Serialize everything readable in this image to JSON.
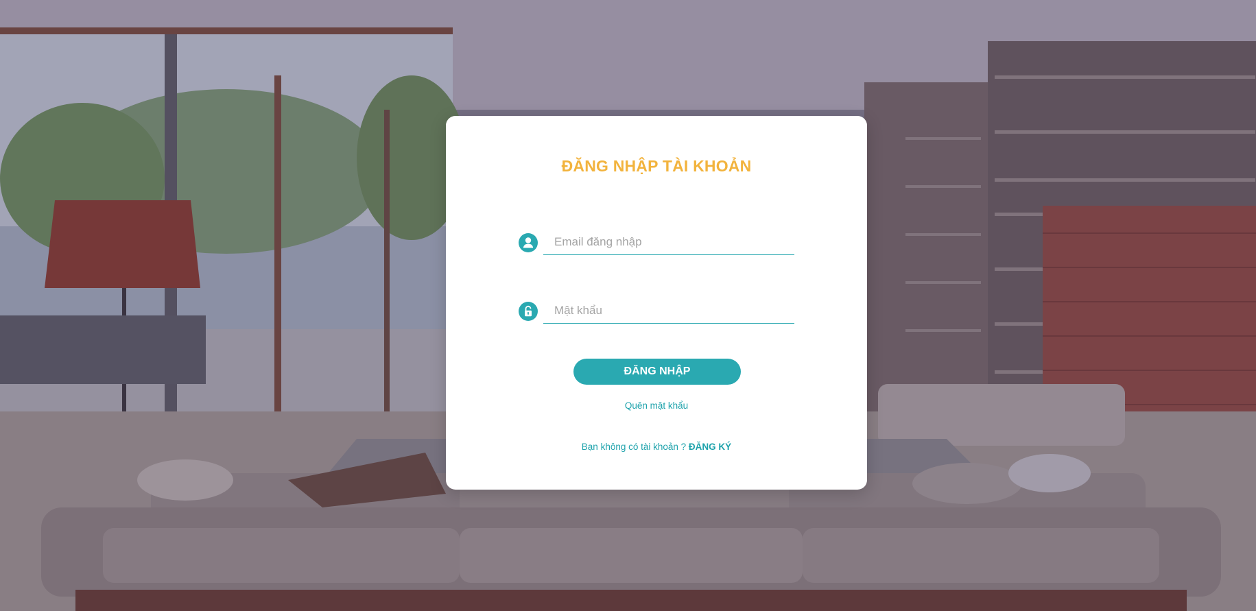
{
  "colors": {
    "accent": "#2aa9b1",
    "title": "#f2b33d",
    "link": "#1fa3ac"
  },
  "login": {
    "title": "ĐĂNG NHẬP TÀI KHOẢN",
    "email": {
      "icon": "user-icon",
      "placeholder": "Email đăng nhập",
      "value": ""
    },
    "password": {
      "icon": "lock-icon",
      "placeholder": "Mật khẩu",
      "value": ""
    },
    "submit_label": "ĐĂNG NHẬP",
    "forgot_label": "Quên mật khẩu",
    "signup_prompt": "Bạn không có tài khoản ? ",
    "signup_label": "ĐĂNG KÝ"
  }
}
